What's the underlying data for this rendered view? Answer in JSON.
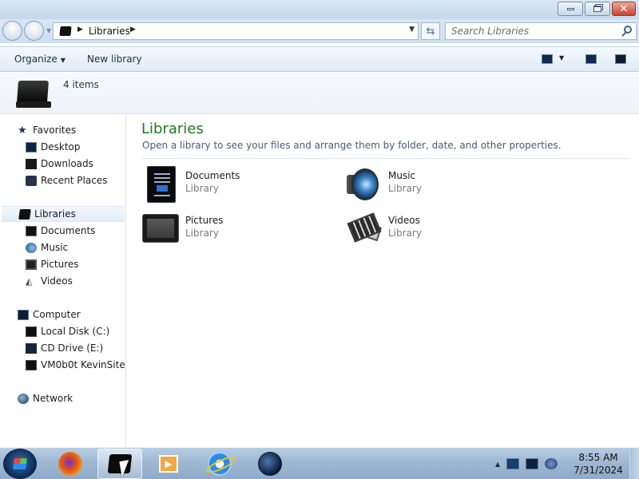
{
  "window": {
    "min_label": "",
    "restore_label": "",
    "close_label": ""
  },
  "address": {
    "breadcrumb": "Libraries",
    "search_placeholder": "Search Libraries"
  },
  "command_bar": {
    "organize": "Organize",
    "new_library": "New library"
  },
  "details": {
    "item_count": "4 items"
  },
  "nav": {
    "favorites": "Favorites",
    "desktop": "Desktop",
    "downloads": "Downloads",
    "recent_places": "Recent Places",
    "libraries": "Libraries",
    "documents": "Documents",
    "music": "Music",
    "pictures": "Pictures",
    "videos": "Videos",
    "computer": "Computer",
    "local_disk": "Local Disk (C:)",
    "cd_drive": "CD Drive (E:)",
    "share": "VM0b0t KevinSite",
    "network": "Network"
  },
  "content": {
    "title": "Libraries",
    "subtitle": "Open a library to see your files and arrange them by folder, date, and other properties.",
    "libraries": [
      {
        "name": "Documents",
        "type": "Library",
        "icon": "documents-icon"
      },
      {
        "name": "Music",
        "type": "Library",
        "icon": "music-icon"
      },
      {
        "name": "Pictures",
        "type": "Library",
        "icon": "pictures-icon"
      },
      {
        "name": "Videos",
        "type": "Library",
        "icon": "videos-icon"
      }
    ]
  },
  "taskbar": {
    "clock_time": "8:55 AM",
    "clock_date": "7/31/2024",
    "apps": [
      "firefox-icon",
      "libraries-icon",
      "media-player-icon",
      "internet-explorer-icon",
      "network-globe-icon"
    ]
  },
  "colors": {
    "title_green": "#1e7b1e",
    "chrome_blue": "#cddff2",
    "taskbar": "#9fb8d3"
  }
}
